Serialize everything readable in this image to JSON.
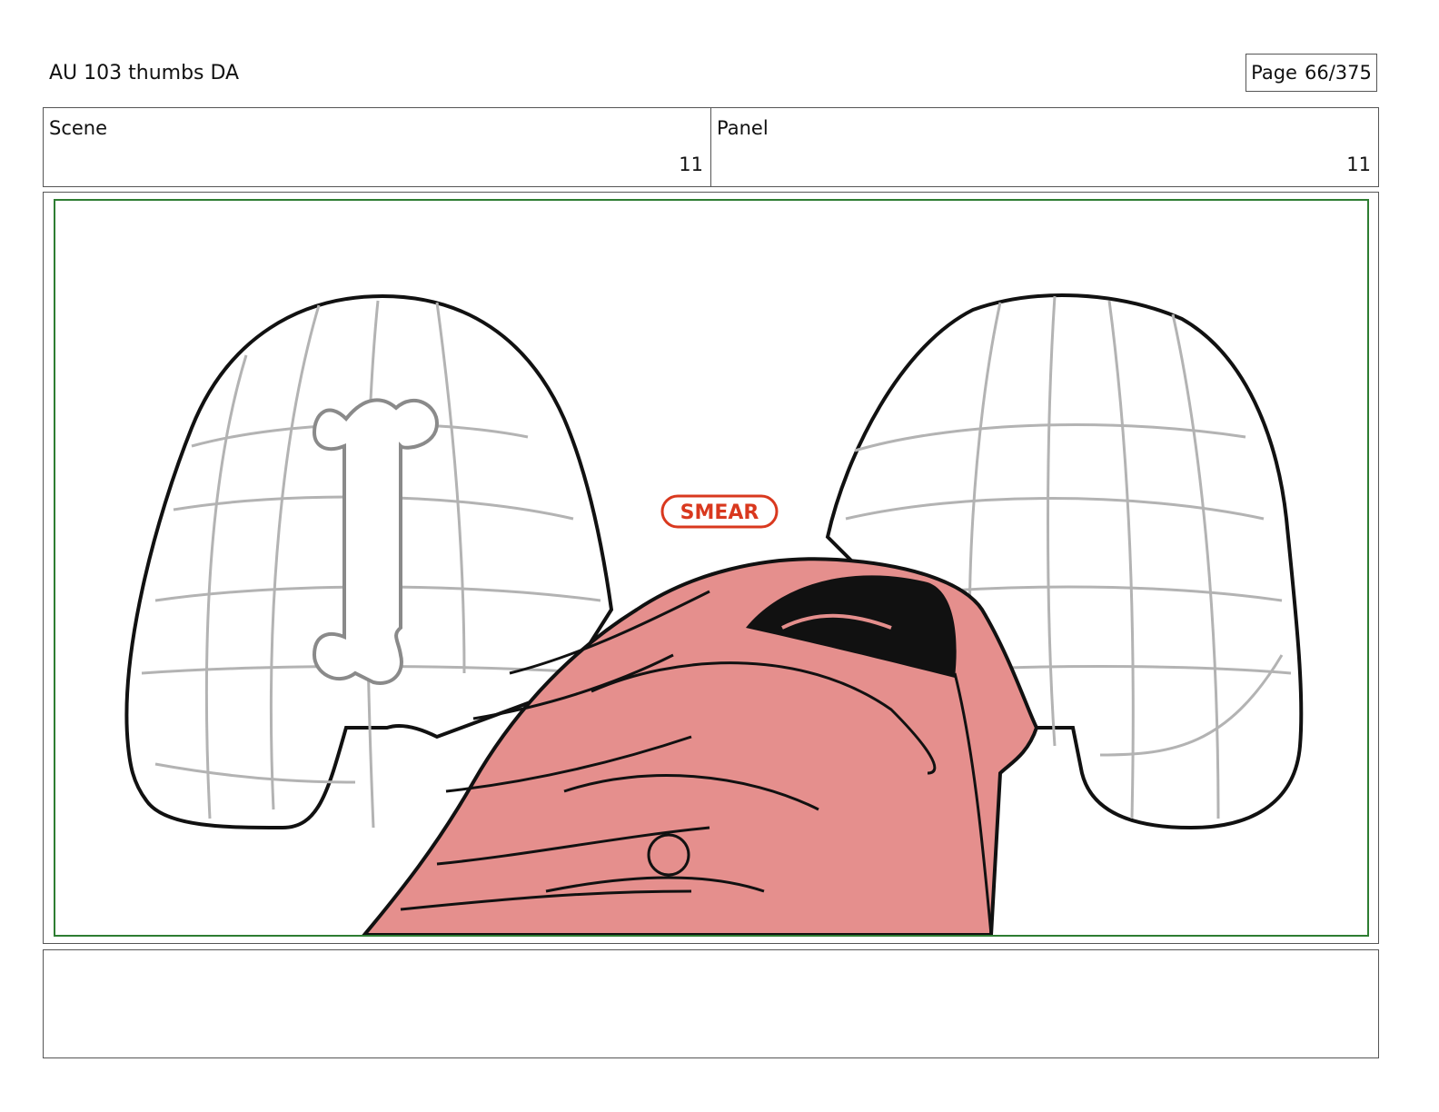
{
  "header": {
    "title": "AU 103 thumbs DA",
    "page_label": "Page",
    "page_value": "66/375"
  },
  "panel_info": {
    "scene_label": "Scene",
    "scene_value": "11",
    "panel_label": "Panel",
    "panel_value": "11"
  },
  "drawing": {
    "annotation": "SMEAR",
    "colors": {
      "frame_border": "#2e7d32",
      "smear_red": "#d9381e",
      "dog_pink": "#e58f8d",
      "grid_gray": "#b3b3b3"
    }
  },
  "notes": {
    "text": ""
  }
}
